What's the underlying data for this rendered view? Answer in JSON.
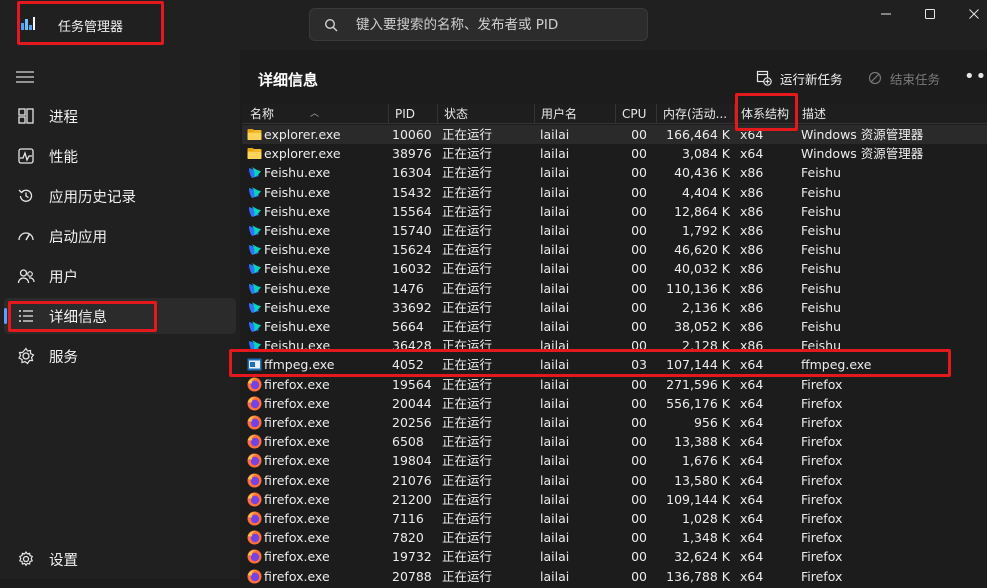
{
  "app": {
    "title": "任务管理器"
  },
  "search": {
    "placeholder": "键入要搜索的名称、发布者或 PID"
  },
  "sidebar": {
    "items": [
      {
        "label": "进程",
        "icon": "processes-icon"
      },
      {
        "label": "性能",
        "icon": "performance-icon"
      },
      {
        "label": "应用历史记录",
        "icon": "app-history-icon"
      },
      {
        "label": "启动应用",
        "icon": "startup-apps-icon"
      },
      {
        "label": "用户",
        "icon": "users-icon"
      },
      {
        "label": "详细信息",
        "icon": "details-icon"
      },
      {
        "label": "服务",
        "icon": "services-icon"
      }
    ],
    "active_index": 5,
    "settings_label": "设置"
  },
  "main": {
    "title": "详细信息",
    "run_task_label": "运行新任务",
    "end_task_label": "结束任务"
  },
  "table": {
    "columns": [
      "名称",
      "PID",
      "状态",
      "用户名",
      "CPU",
      "内存(活动...",
      "体系结构",
      "描述"
    ],
    "rows": [
      {
        "name": "explorer.exe",
        "pid": "10060",
        "status": "正在运行",
        "user": "lailai",
        "cpu": "00",
        "mem": "166,464 K",
        "arch": "x64",
        "desc": "Windows 资源管理器",
        "icon": "explorer"
      },
      {
        "name": "explorer.exe",
        "pid": "38976",
        "status": "正在运行",
        "user": "lailai",
        "cpu": "00",
        "mem": "3,084 K",
        "arch": "x64",
        "desc": "Windows 资源管理器",
        "icon": "explorer"
      },
      {
        "name": "Feishu.exe",
        "pid": "16304",
        "status": "正在运行",
        "user": "lailai",
        "cpu": "00",
        "mem": "40,436 K",
        "arch": "x86",
        "desc": "Feishu",
        "icon": "feishu"
      },
      {
        "name": "Feishu.exe",
        "pid": "15432",
        "status": "正在运行",
        "user": "lailai",
        "cpu": "00",
        "mem": "4,404 K",
        "arch": "x86",
        "desc": "Feishu",
        "icon": "feishu"
      },
      {
        "name": "Feishu.exe",
        "pid": "15564",
        "status": "正在运行",
        "user": "lailai",
        "cpu": "00",
        "mem": "12,864 K",
        "arch": "x86",
        "desc": "Feishu",
        "icon": "feishu"
      },
      {
        "name": "Feishu.exe",
        "pid": "15740",
        "status": "正在运行",
        "user": "lailai",
        "cpu": "00",
        "mem": "1,792 K",
        "arch": "x86",
        "desc": "Feishu",
        "icon": "feishu"
      },
      {
        "name": "Feishu.exe",
        "pid": "15624",
        "status": "正在运行",
        "user": "lailai",
        "cpu": "00",
        "mem": "46,620 K",
        "arch": "x86",
        "desc": "Feishu",
        "icon": "feishu"
      },
      {
        "name": "Feishu.exe",
        "pid": "16032",
        "status": "正在运行",
        "user": "lailai",
        "cpu": "00",
        "mem": "40,032 K",
        "arch": "x86",
        "desc": "Feishu",
        "icon": "feishu"
      },
      {
        "name": "Feishu.exe",
        "pid": "1476",
        "status": "正在运行",
        "user": "lailai",
        "cpu": "00",
        "mem": "110,136 K",
        "arch": "x86",
        "desc": "Feishu",
        "icon": "feishu"
      },
      {
        "name": "Feishu.exe",
        "pid": "33692",
        "status": "正在运行",
        "user": "lailai",
        "cpu": "00",
        "mem": "2,136 K",
        "arch": "x86",
        "desc": "Feishu",
        "icon": "feishu"
      },
      {
        "name": "Feishu.exe",
        "pid": "5664",
        "status": "正在运行",
        "user": "lailai",
        "cpu": "00",
        "mem": "38,052 K",
        "arch": "x86",
        "desc": "Feishu",
        "icon": "feishu"
      },
      {
        "name": "Feishu.exe",
        "pid": "36428",
        "status": "正在运行",
        "user": "lailai",
        "cpu": "00",
        "mem": "2,128 K",
        "arch": "x86",
        "desc": "Feishu",
        "icon": "feishu"
      },
      {
        "name": "ffmpeg.exe",
        "pid": "4052",
        "status": "正在运行",
        "user": "lailai",
        "cpu": "03",
        "mem": "107,144 K",
        "arch": "x64",
        "desc": "ffmpeg.exe",
        "icon": "ffmpeg"
      },
      {
        "name": "firefox.exe",
        "pid": "19564",
        "status": "正在运行",
        "user": "lailai",
        "cpu": "00",
        "mem": "271,596 K",
        "arch": "x64",
        "desc": "Firefox",
        "icon": "firefox"
      },
      {
        "name": "firefox.exe",
        "pid": "20044",
        "status": "正在运行",
        "user": "lailai",
        "cpu": "00",
        "mem": "556,176 K",
        "arch": "x64",
        "desc": "Firefox",
        "icon": "firefox"
      },
      {
        "name": "firefox.exe",
        "pid": "20256",
        "status": "正在运行",
        "user": "lailai",
        "cpu": "00",
        "mem": "956 K",
        "arch": "x64",
        "desc": "Firefox",
        "icon": "firefox"
      },
      {
        "name": "firefox.exe",
        "pid": "6508",
        "status": "正在运行",
        "user": "lailai",
        "cpu": "00",
        "mem": "13,388 K",
        "arch": "x64",
        "desc": "Firefox",
        "icon": "firefox"
      },
      {
        "name": "firefox.exe",
        "pid": "19804",
        "status": "正在运行",
        "user": "lailai",
        "cpu": "00",
        "mem": "1,676 K",
        "arch": "x64",
        "desc": "Firefox",
        "icon": "firefox"
      },
      {
        "name": "firefox.exe",
        "pid": "21076",
        "status": "正在运行",
        "user": "lailai",
        "cpu": "00",
        "mem": "13,580 K",
        "arch": "x64",
        "desc": "Firefox",
        "icon": "firefox"
      },
      {
        "name": "firefox.exe",
        "pid": "21200",
        "status": "正在运行",
        "user": "lailai",
        "cpu": "00",
        "mem": "109,144 K",
        "arch": "x64",
        "desc": "Firefox",
        "icon": "firefox"
      },
      {
        "name": "firefox.exe",
        "pid": "7116",
        "status": "正在运行",
        "user": "lailai",
        "cpu": "00",
        "mem": "1,028 K",
        "arch": "x64",
        "desc": "Firefox",
        "icon": "firefox"
      },
      {
        "name": "firefox.exe",
        "pid": "7820",
        "status": "正在运行",
        "user": "lailai",
        "cpu": "00",
        "mem": "1,348 K",
        "arch": "x64",
        "desc": "Firefox",
        "icon": "firefox"
      },
      {
        "name": "firefox.exe",
        "pid": "19732",
        "status": "正在运行",
        "user": "lailai",
        "cpu": "00",
        "mem": "32,624 K",
        "arch": "x64",
        "desc": "Firefox",
        "icon": "firefox"
      },
      {
        "name": "firefox.exe",
        "pid": "20788",
        "status": "正在运行",
        "user": "lailai",
        "cpu": "00",
        "mem": "136,788 K",
        "arch": "x64",
        "desc": "Firefox",
        "icon": "firefox"
      }
    ]
  },
  "colors": {
    "background": "#1c1c1c",
    "sidebar": "#202020",
    "accent": "#5aa0ff",
    "annotation": "#e3191e"
  }
}
